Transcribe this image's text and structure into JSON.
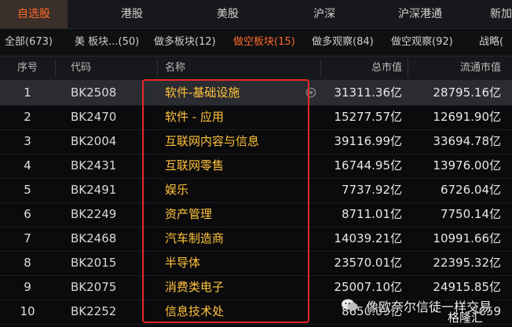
{
  "top_tabs": [
    "自选股",
    "港股",
    "美股",
    "沪深",
    "沪深港通",
    "新加"
  ],
  "sub_tabs": [
    "全部(673)",
    "美 板块...(50)",
    "做多板块(12)",
    "做空板块(15)",
    "做多观察(84)",
    "做空观察(92)",
    "战略("
  ],
  "columns": {
    "idx": "序号",
    "code": "代码",
    "name": "名称",
    "mv": "总市值",
    "fmv": "流通市值"
  },
  "rows": [
    {
      "idx": "1",
      "code": "BK2508",
      "name": "软件-基础设施",
      "mv": "31311.36亿",
      "fmv": "28795.16亿"
    },
    {
      "idx": "2",
      "code": "BK2470",
      "name": "软件 - 应用",
      "mv": "15277.57亿",
      "fmv": "12691.90亿"
    },
    {
      "idx": "3",
      "code": "BK2004",
      "name": "互联网内容与信息",
      "mv": "39116.99亿",
      "fmv": "33694.78亿"
    },
    {
      "idx": "4",
      "code": "BK2431",
      "name": "互联网零售",
      "mv": "16744.95亿",
      "fmv": "13976.00亿"
    },
    {
      "idx": "5",
      "code": "BK2491",
      "name": "娱乐",
      "mv": "7737.92亿",
      "fmv": "6726.04亿"
    },
    {
      "idx": "6",
      "code": "BK2249",
      "name": "资产管理",
      "mv": "8711.01亿",
      "fmv": "7750.14亿"
    },
    {
      "idx": "7",
      "code": "BK2468",
      "name": "汽车制造商",
      "mv": "14039.21亿",
      "fmv": "10991.66亿"
    },
    {
      "idx": "8",
      "code": "BK2015",
      "name": "半导体",
      "mv": "23570.01亿",
      "fmv": "22395.32亿"
    },
    {
      "idx": "9",
      "code": "BK2075",
      "name": "消费类电子",
      "mv": "25007.10亿",
      "fmv": "24915.85亿"
    },
    {
      "idx": "10",
      "code": "BK2252",
      "name": "信息技术处",
      "mv": "8650.09亿",
      "fmv": "7659"
    }
  ],
  "watermark": {
    "text": "像欧奈尔信徒一样交易",
    "logo": "格隆汇"
  },
  "colors": {
    "accent": "#ff6a2a",
    "name": "#ffc23a",
    "highlight_box": "#e8282a"
  }
}
